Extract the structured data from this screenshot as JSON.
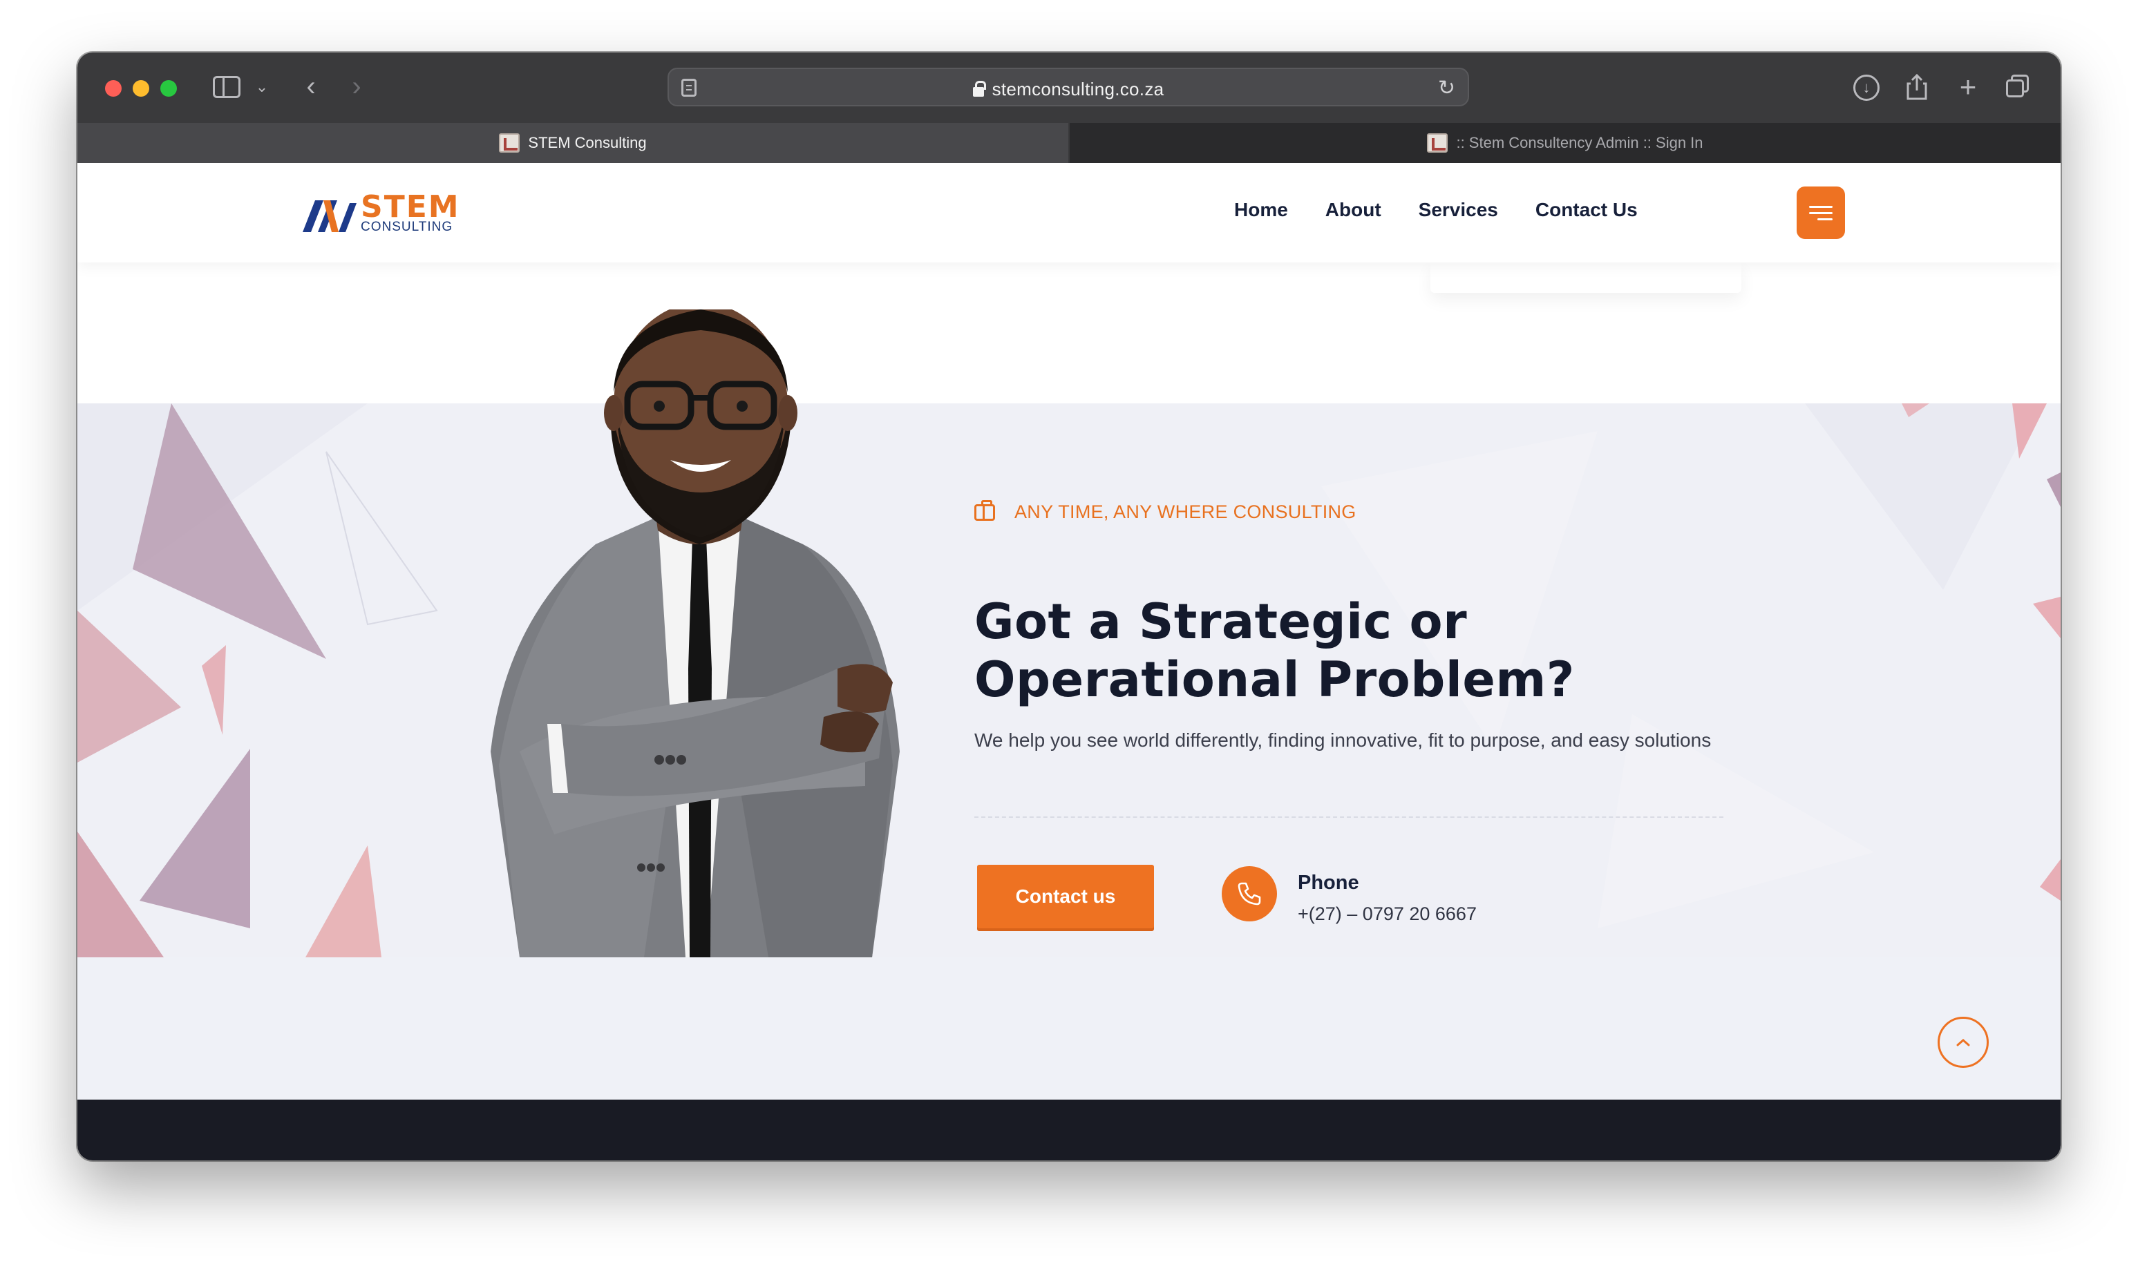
{
  "browser": {
    "url": "stemconsulting.co.za",
    "tabs": [
      {
        "title": "STEM Consulting"
      },
      {
        "title": ":: Stem Consultency Admin :: Sign In"
      }
    ]
  },
  "site": {
    "logo": {
      "word": "STEM",
      "sub": "CONSULTING"
    },
    "nav": [
      {
        "label": "Home"
      },
      {
        "label": "About"
      },
      {
        "label": "Services"
      },
      {
        "label": "Contact Us"
      }
    ]
  },
  "hero": {
    "tagline": "ANY TIME, ANY WHERE CONSULTING",
    "headline_line1": "Got a Strategic or",
    "headline_line2": "Operational Problem?",
    "subtext": "We help you see world differently, finding innovative, fit to purpose, and easy solutions",
    "cta_label": "Contact us",
    "phone_label": "Phone",
    "phone_number": "+(27) – 0797 20 6667"
  },
  "colors": {
    "accent": "#ee7222",
    "navy": "#17203a",
    "hero_bg": "#eff0f6",
    "footer": "#191b24"
  }
}
